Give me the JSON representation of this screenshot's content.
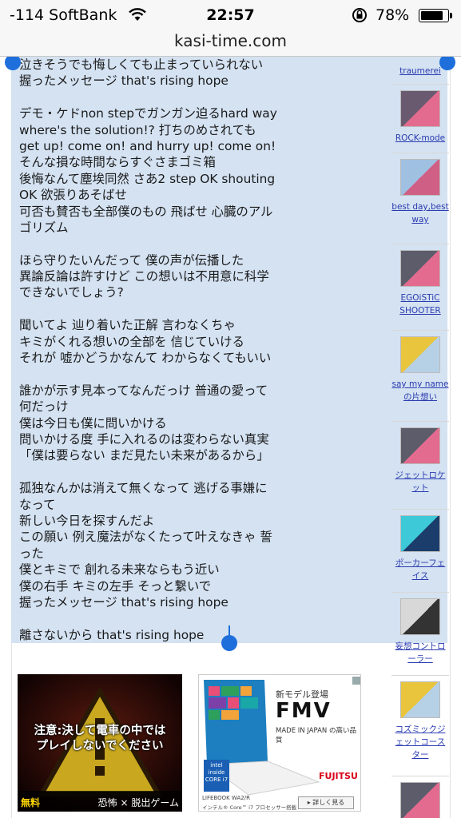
{
  "status_bar": {
    "carrier": "-114 SoftBank",
    "time": "22:57",
    "battery": "78%"
  },
  "browser": {
    "url": "kasi-time.com"
  },
  "lyrics": [
    "泣きそうでも悔しくても止まっていられない",
    "握ったメッセージ that's rising hope",
    "",
    "デモ・ケドnon stepでガンガン迫るhard way",
    "where's the solution!? 打ちのめされても",
    "get up! come on! and hurry up! come on!",
    "そんな損な時間ならすぐさまゴミ箱",
    "後悔なんて塵埃同然 さあ2 step OK shouting",
    " OK 欲張りあそばせ",
    "可否も賛否も全部僕のもの 飛ばせ 心臓のアル",
    "ゴリズム",
    "",
    "ほら守りたいんだって 僕の声が伝播した",
    "異論反論は許すけど この想いは不用意に科学",
    "できないでしょう?",
    "",
    "聞いてよ 辿り着いた正解 言わなくちゃ",
    "キミがくれる想いの全部を 信じていける",
    "それが 嘘かどうかなんて わからなくてもいい",
    "",
    "誰かが示す見本ってなんだっけ 普通の愛って",
    "何だっけ",
    "僕は今日も僕に問いかける",
    "問いかける度 手に入れるのは変わらない真実",
    "「僕は要らない まだ見たい未来があるから」",
    "",
    "孤独なんかは消えて無くなって 逃げる事嫌に",
    "なって",
    "新しい今日を探すんだよ",
    "この願い 例え魔法がなくたって叶えなきゃ 誓",
    "った",
    "僕とキミで 創れる未来ならもう近い",
    "僕の右手 キミの左手 そっと繋いで",
    "握ったメッセージ that's rising hope",
    "",
    "離さないから that's rising hope"
  ],
  "sidebar": {
    "items": [
      {
        "label_lines": [
          "traumerei"
        ],
        "thumb_colors": [
          "#f3f3f3",
          "#e8e8e8"
        ]
      },
      {
        "label_lines": [
          "ROCK-mode"
        ],
        "thumb_colors": [
          "#6a5a70",
          "#e36b8f"
        ]
      },
      {
        "label_lines": [
          "best day,best",
          "way"
        ],
        "thumb_colors": [
          "#9fc0e0",
          "#d05f86"
        ]
      },
      {
        "label_lines": [
          "EGOiSTiC",
          "SHOOTER"
        ],
        "thumb_colors": [
          "#5c5c6b",
          "#e36b8f"
        ]
      },
      {
        "label_lines": [
          "say my name",
          "の片想い"
        ],
        "thumb_colors": [
          "#e8c53d",
          "#b6d0e6"
        ]
      },
      {
        "label_lines": [
          "ジェットロケ",
          "ット"
        ],
        "thumb_colors": [
          "#5c5c6b",
          "#e36b8f"
        ]
      },
      {
        "label_lines": [
          "ポーカーフェ",
          "イス"
        ],
        "thumb_colors": [
          "#3ec9d9",
          "#1a3d6c"
        ]
      },
      {
        "label_lines": [
          "妄想コントロ",
          "ーラー"
        ],
        "thumb_colors": [
          "#d8d8d8",
          "#333333"
        ]
      },
      {
        "label_lines": [
          "コズミックジ",
          "ェットコース",
          "ター"
        ],
        "thumb_colors": [
          "#e8c53d",
          "#b6d0e6"
        ]
      },
      {
        "label_lines": [],
        "thumb_colors": [
          "#5c5c6b",
          "#e36b8f"
        ]
      }
    ]
  },
  "ads": {
    "game": {
      "headline_1": "注意:決して電車の中では",
      "headline_2": "プレイしないでください",
      "tag": "無料",
      "genre": "恐怖 × 脱出ゲーム"
    },
    "laptop": {
      "tagline": "新モデル登場",
      "brand": "FMV",
      "made_in": "MADE IN JAPAN の高い品質",
      "maker": "FUJITSU",
      "intel_1": "intel",
      "intel_2": "inside",
      "intel_3": "CORE i7",
      "model": "LIFEBOOK WA2/R",
      "cpu": "インテル® Core™ i7 プロセッサー搭載",
      "more": "詳しく見る"
    }
  },
  "colors": {
    "selection": "#d4e2f2",
    "handle": "#1e6fdc",
    "link": "#2a3bb0"
  }
}
